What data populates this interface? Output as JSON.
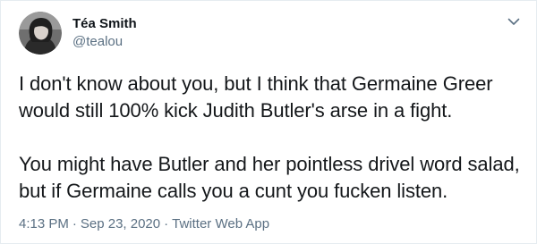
{
  "author": {
    "display_name": "Téa Smith",
    "handle": "@tealou",
    "avatar_icon": "user-avatar-photo"
  },
  "tweet": {
    "paragraphs": [
      "I don't know about you, but I think that Germaine Greer would still 100% kick Judith Butler's arse in a fight.",
      "You might have Butler and her pointless drivel word salad, but if Germaine calls you a cunt you fucken listen."
    ],
    "time": "4:13 PM",
    "date": "Sep 23, 2020",
    "separator": "·",
    "source": "Twitter Web App"
  },
  "menu": {
    "icon": "chevron-down-icon"
  },
  "colors": {
    "text": "#0f1419",
    "secondary": "#5b7083",
    "border": "#e6ecf0"
  }
}
